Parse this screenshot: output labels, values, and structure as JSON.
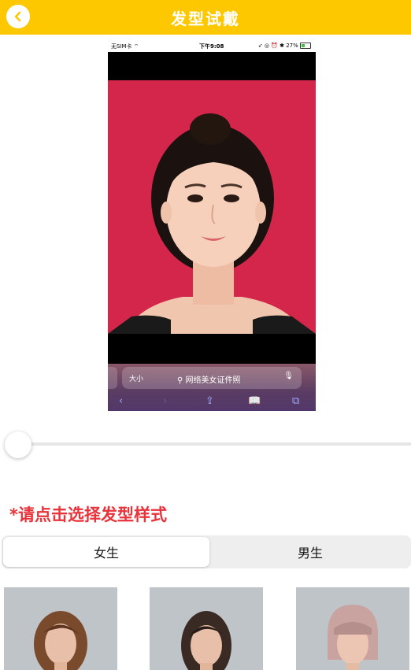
{
  "header": {
    "title": "发型试戴",
    "accent": "#FDC800"
  },
  "preview": {
    "status": {
      "carrier": "无SIM卡",
      "time": "下午9:08",
      "battery": "27%"
    },
    "browser": {
      "text_size": "大小",
      "query": "网络美女证件照"
    }
  },
  "instruction": "*请点击选择发型样式",
  "tabs": {
    "female": "女生",
    "male": "男生"
  },
  "colors": {
    "instruction": "#E8333A",
    "photo_bg": "#D4264A"
  },
  "hairstyles": [
    "brown-wavy-bob",
    "dark-wavy-medium",
    "pink-bob-bangs"
  ]
}
